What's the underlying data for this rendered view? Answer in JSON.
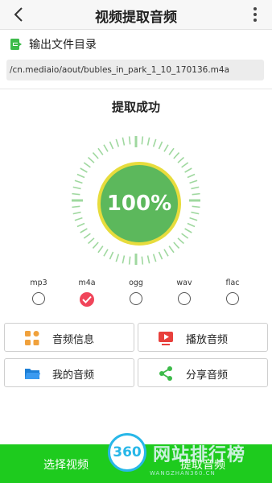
{
  "header": {
    "title": "视频提取音频"
  },
  "output": {
    "label": "输出文件目录",
    "path": "/cn.mediaio/aout/bubles_in_park_1_10_170136.m4a"
  },
  "status": {
    "text": "提取成功",
    "progress_text": "100%",
    "progress": 1.0
  },
  "formats": [
    {
      "label": "mp3",
      "selected": false
    },
    {
      "label": "m4a",
      "selected": true
    },
    {
      "label": "ogg",
      "selected": false
    },
    {
      "label": "wav",
      "selected": false
    },
    {
      "label": "flac",
      "selected": false
    }
  ],
  "actions": {
    "audio_info": "音频信息",
    "play_audio": "播放音频",
    "my_audio": "我的音频",
    "share_audio": "分享音频"
  },
  "bottom": {
    "select_video": "选择视频",
    "extract_audio": "提取音频"
  },
  "watermark": {
    "badge": "360",
    "text": "网站排行榜",
    "sub": "WANGZHAN360.CN"
  },
  "colors": {
    "accent_green": "#5cb85c",
    "ring_yellow": "#e7dc3c",
    "bottom_bar": "#1ecb1e",
    "check_red": "#f0455a"
  },
  "icons": [
    "back-arrow-icon",
    "more-vertical-icon",
    "export-icon",
    "grid-icon",
    "play-icon",
    "folder-icon",
    "share-icon",
    "check-icon"
  ]
}
